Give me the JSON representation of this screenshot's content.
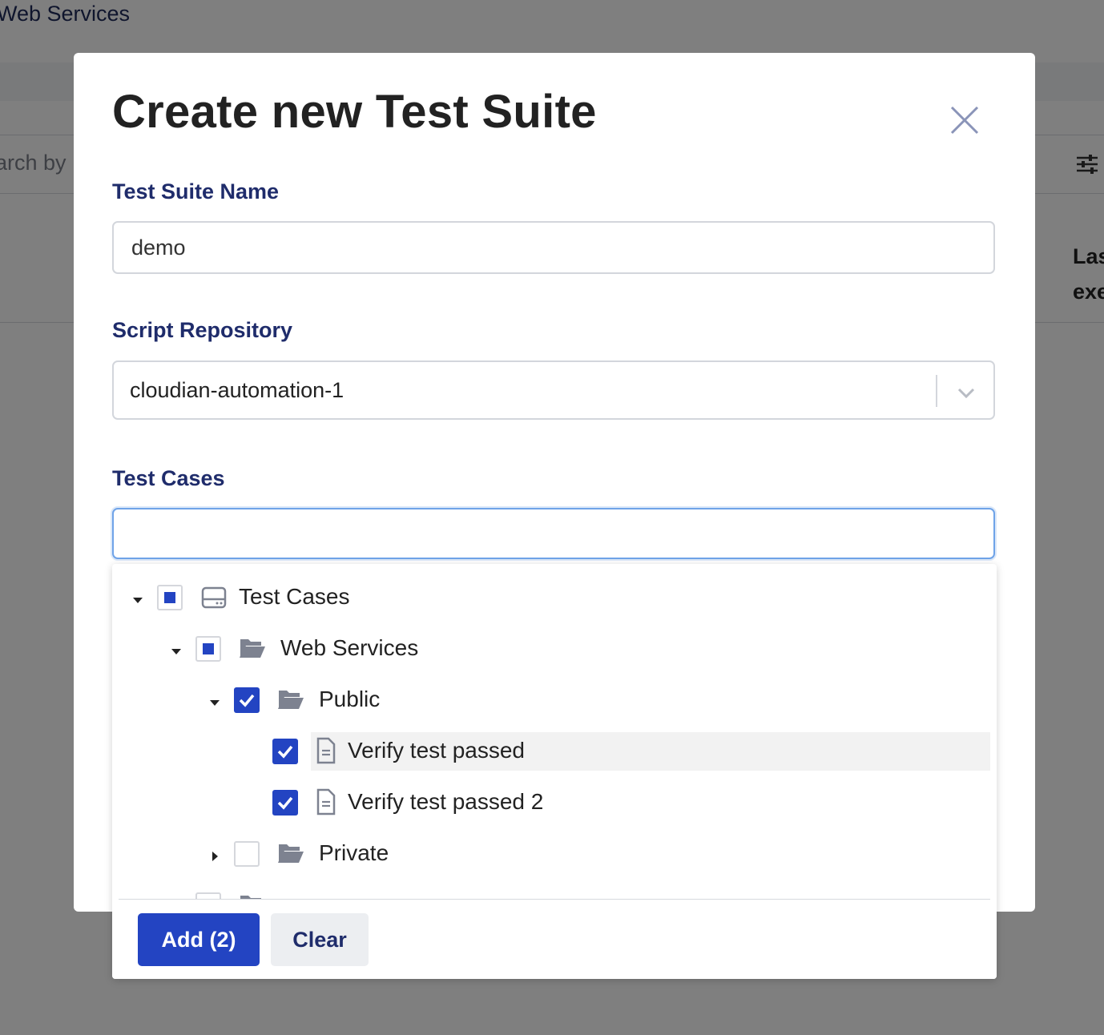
{
  "background": {
    "page_title": "Web Services",
    "search_placeholder": "arch by",
    "column_header_line1": "Las",
    "column_header_line2": "exe"
  },
  "modal": {
    "title": "Create new Test Suite",
    "suite_name": {
      "label": "Test Suite Name",
      "value": "demo"
    },
    "repository": {
      "label": "Script Repository",
      "selected": "cloudian-automation-1"
    },
    "test_cases": {
      "label": "Test Cases",
      "search_value": "",
      "tree": [
        {
          "label": "Test Cases",
          "icon": "drive-icon",
          "state": "partial",
          "expanded": true
        },
        {
          "label": "Web Services",
          "icon": "folder-open-icon",
          "state": "partial",
          "expanded": true
        },
        {
          "label": "Public",
          "icon": "folder-open-icon",
          "state": "checked",
          "expanded": true
        },
        {
          "label": "Verify test passed",
          "icon": "file-icon",
          "state": "checked"
        },
        {
          "label": "Verify test passed 2",
          "icon": "file-icon",
          "state": "checked"
        },
        {
          "label": "Private",
          "icon": "folder-open-icon",
          "state": "unchecked",
          "expanded": false
        }
      ],
      "add_button": "Add (2)",
      "clear_button": "Clear"
    }
  },
  "colors": {
    "accent": "#2344c2",
    "label": "#1f2c6b",
    "focus": "#6fa3e8"
  }
}
